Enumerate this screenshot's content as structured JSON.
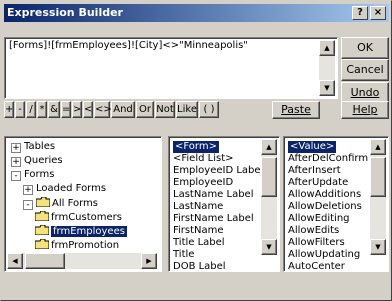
{
  "window": {
    "title": "Expression Builder",
    "help_label": "?",
    "close_label": "×"
  },
  "expression": {
    "value": "[Forms]![frmEmployees]![City]<>\"Minneapolis\""
  },
  "buttons": {
    "ok": "OK",
    "cancel": "Cancel",
    "undo": "Undo",
    "paste": "Paste",
    "help": "Help"
  },
  "operators": [
    "+",
    "-",
    "/",
    "*",
    "&",
    "=",
    ">",
    "<",
    "<>",
    "And",
    "Or",
    "Not",
    "Like",
    "( )"
  ],
  "left_tree": {
    "items": [
      {
        "label": "Tables",
        "box": "+"
      },
      {
        "label": "Queries",
        "box": "+"
      },
      {
        "label": "Forms",
        "box": "-"
      },
      {
        "label": "Loaded Forms",
        "box": "+"
      },
      {
        "label": "All Forms",
        "box": "-"
      },
      {
        "label": "frmCustomers",
        "box": ""
      },
      {
        "label": "frmEmployees",
        "box": ""
      },
      {
        "label": "frmPromotion",
        "box": ""
      }
    ]
  },
  "middle_list": {
    "items": [
      "<Form>",
      "<Field List>",
      "EmployeeID Label",
      "EmployeeID",
      "LastName Label",
      "LastName",
      "FirstName Label",
      "FirstName",
      "Title Label",
      "Title",
      "DOB Label"
    ]
  },
  "right_list": {
    "items": [
      "<Value>",
      "AfterDelConfirm",
      "AfterInsert",
      "AfterUpdate",
      "AllowAdditions",
      "AllowDeletions",
      "AllowEditing",
      "AllowEdits",
      "AllowFilters",
      "AllowUpdating",
      "AutoCenter"
    ]
  }
}
